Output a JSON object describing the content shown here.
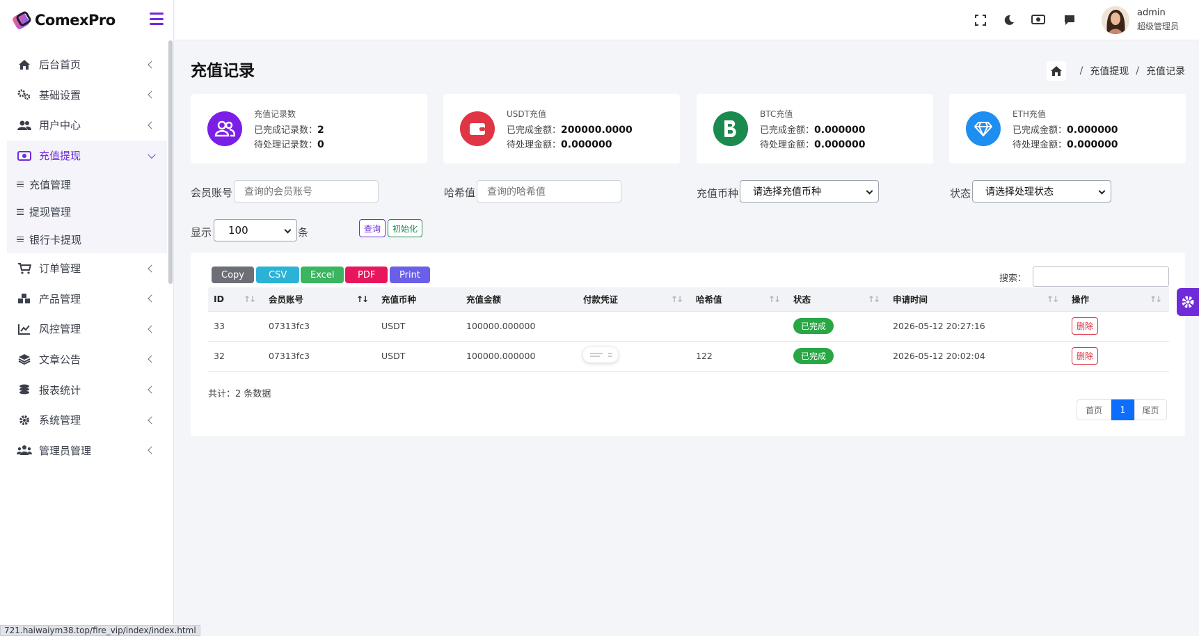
{
  "brand": {
    "name": "ComexPro"
  },
  "sidebar": {
    "items": [
      {
        "label": "后台首页",
        "icon": "home-icon"
      },
      {
        "label": "基础设置",
        "icon": "cogs-icon"
      },
      {
        "label": "用户中心",
        "icon": "users-icon"
      },
      {
        "label": "充值提现",
        "icon": "money-icon",
        "active": true
      },
      {
        "label": "订单管理",
        "icon": "cart-icon"
      },
      {
        "label": "产品管理",
        "icon": "cubes-icon"
      },
      {
        "label": "风控管理",
        "icon": "chart-line-icon"
      },
      {
        "label": "文章公告",
        "icon": "layers-icon"
      },
      {
        "label": "报表统计",
        "icon": "coins-icon"
      },
      {
        "label": "系统管理",
        "icon": "gear-icon"
      },
      {
        "label": "管理员管理",
        "icon": "user-group-icon"
      }
    ],
    "subitems": [
      "充值管理",
      "提现管理",
      "银行卡提现"
    ]
  },
  "topbar": {
    "user_name": "admin",
    "user_role": "超级管理员"
  },
  "page": {
    "title": "充值记录"
  },
  "breadcrumb": {
    "level1": "充值提现",
    "level2": "充值记录"
  },
  "cards": [
    {
      "title": "充值记录数",
      "l1_label": "已完成记录数：",
      "l1_value": "2",
      "l2_label": "待处理记录数：",
      "l2_value": "0",
      "color": "#7b1fe6"
    },
    {
      "title": "USDT充值",
      "l1_label": "已完成金额：",
      "l1_value": "200000.0000",
      "l2_label": "待处理金额：",
      "l2_value": "0.000000",
      "color": "#e03545"
    },
    {
      "title": "BTC充值",
      "l1_label": "已完成金额：",
      "l1_value": "0.000000",
      "l2_label": "待处理金额：",
      "l2_value": "0.000000",
      "color": "#1a8a4e"
    },
    {
      "title": "ETH充值",
      "l1_label": "已完成金额：",
      "l1_value": "0.000000",
      "l2_label": "待处理金额：",
      "l2_value": "0.000000",
      "color": "#1e8ef0"
    }
  ],
  "filters": {
    "member_label": "会员账号",
    "member_placeholder": "查询的会员账号",
    "hash_label": "哈希值",
    "hash_placeholder": "查询的哈希值",
    "coin_label": "充值币种",
    "coin_value": "请选择充值币种",
    "status_label": "状态",
    "status_value": "请选择处理状态",
    "show_label": "显示",
    "show_value": "100",
    "unit_label": "条",
    "query_btn": "查询",
    "reset_btn": "初始化"
  },
  "export_buttons": [
    {
      "label": "Copy",
      "color": "#6c6f75"
    },
    {
      "label": "CSV",
      "color": "#2ab3d6"
    },
    {
      "label": "Excel",
      "color": "#3bb55f"
    },
    {
      "label": "PDF",
      "color": "#e8175d"
    },
    {
      "label": "Print",
      "color": "#6a5fe8"
    }
  ],
  "search_label": "搜索：",
  "table": {
    "columns": [
      "ID",
      "会员账号",
      "充值币种",
      "充值金额",
      "付款凭证",
      "哈希值",
      "状态",
      "申请时间",
      "操作"
    ],
    "rows": [
      {
        "id": "33",
        "account": "07313fc3",
        "coin": "USDT",
        "amount": "100000.000000",
        "voucher": false,
        "hash": "",
        "status": "已完成",
        "time": "2026-05-12 20:27:16",
        "action": "删除"
      },
      {
        "id": "32",
        "account": "07313fc3",
        "coin": "USDT",
        "amount": "100000.000000",
        "voucher": true,
        "hash": "122",
        "status": "已完成",
        "time": "2026-05-12 20:02:04",
        "action": "删除"
      }
    ]
  },
  "footer": {
    "total": "共计：2 条数据"
  },
  "pagination": {
    "first": "首页",
    "current": "1",
    "last": "尾页"
  },
  "status_url": "721.haiwaiym38.top/fire_vip/index/index.html"
}
